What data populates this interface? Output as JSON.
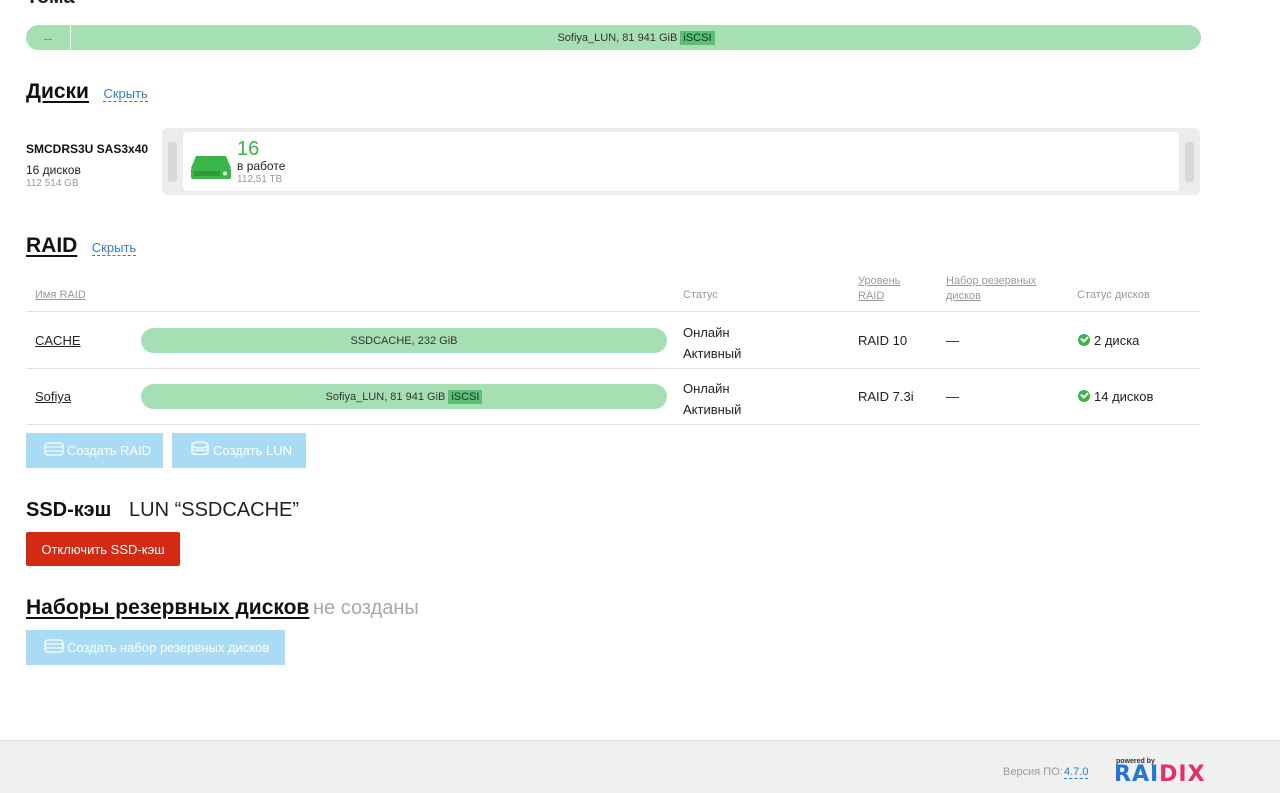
{
  "top": {
    "title": "Тома",
    "more": "...",
    "lun_label": "Sofiya_LUN, 81 941 GiB",
    "lun_tag": "iSCSI"
  },
  "disks": {
    "heading": "Диски",
    "hide": "Скрыть",
    "enclosure_name": "SMCDRS3U SAS3x40",
    "count": "16 дисков",
    "size": "112 514 GB",
    "working_count": "16",
    "working_label": "в работе",
    "working_size": "112,51 TB"
  },
  "raid": {
    "heading": "RAID",
    "hide": "Скрыть",
    "columns": {
      "name": "Имя RAID",
      "status": "Статус",
      "level_1": "Уровень",
      "level_2": "RAID",
      "spare_1": "Набор резервных",
      "spare_2": "дисков",
      "disk_status": "Статус дисков"
    },
    "rows": [
      {
        "name": "CACHE",
        "lun": "SSDCACHE, 232 GiB",
        "lun_tag": "",
        "status_1": "Онлайн",
        "status_2": "Активный",
        "level": "RAID 10",
        "spare": "—",
        "disks": "2 диска"
      },
      {
        "name": "Sofiya",
        "lun": "Sofiya_LUN, 81 941 GiB",
        "lun_tag": "iSCSI",
        "status_1": "Онлайн",
        "status_2": "Активный",
        "level": "RAID 7.3i",
        "spare": "—",
        "disks": "14 дисков"
      }
    ],
    "create_raid": "Создать RAID",
    "create_lun": "Создать LUN"
  },
  "ssd": {
    "heading": "SSD-кэш",
    "lun": "LUN “SSDCACHE”",
    "disable": "Отключить SSD-кэш"
  },
  "spares": {
    "heading": "Наборы резервных дисков",
    "none": "не созданы",
    "create": "Создать набор резервных дисков"
  },
  "footer": {
    "version_label": "Версия ПО:",
    "version": "4.7.0",
    "powered": "powered by",
    "logo_a": "RAI",
    "logo_b": "DIX"
  },
  "colors": {
    "lun_bar": "#a6dfb3",
    "ok": "#39b54a",
    "danger": "#d42a14",
    "disabled_button": "#a9dcf4",
    "link": "#2a7fd0"
  }
}
